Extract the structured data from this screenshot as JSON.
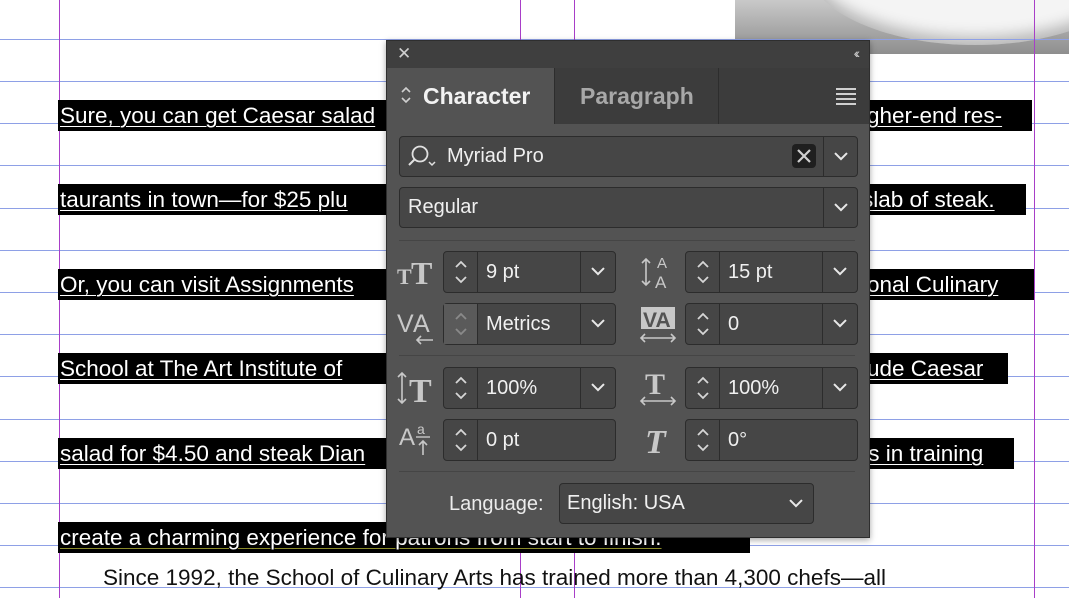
{
  "document": {
    "highlighted_lines": [
      "Sure, you can get Caesar salad",
      "igher-end res-",
      "taurants in town—for $25 plu",
      "slab of steak.",
      "Or, you can visit Assignments",
      "ional Culinary",
      "School at The Art Institute of",
      "lude Caesar",
      "salad for $4.50 and steak Dian",
      "fs in training",
      "create a charming experience for patrons from start to finish."
    ],
    "body_line": "Since 1992, the School of Culinary Arts has trained more than 4,300 chefs—all"
  },
  "panel": {
    "tabs": {
      "character": "Character",
      "paragraph": "Paragraph"
    },
    "font_family": "Myriad Pro",
    "font_style": "Regular",
    "font_size": "9 pt",
    "leading": "15 pt",
    "kerning": "Metrics",
    "tracking": "0",
    "vertical_scale": "100%",
    "horizontal_scale": "100%",
    "baseline_shift": "0 pt",
    "skew": "0°",
    "language_label": "Language:",
    "language": "English: USA"
  },
  "icons": {
    "close": "close-icon",
    "collapse": "double-chevron-left-icon",
    "menu": "hamburger-menu-icon",
    "search": "search-icon",
    "clear": "clear-x-icon"
  },
  "colors": {
    "panel_bg": "#535353",
    "field_bg": "#464646",
    "highlight": "#000000",
    "guide_h": "#8ea0e6",
    "guide_v": "#a83ec8"
  }
}
